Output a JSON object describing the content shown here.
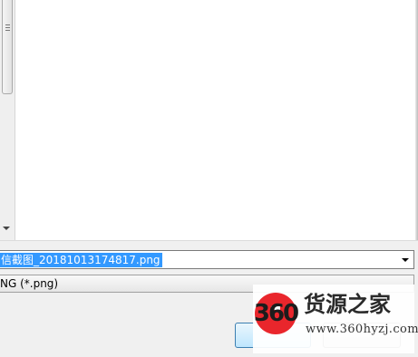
{
  "dialog": {
    "file_name": "信截图_20181013174817.png",
    "file_type": "NG (*.png)",
    "save_label": "",
    "cancel_label": ""
  },
  "watermark": {
    "logo_text": "360",
    "title": "货源之家",
    "url": "www.360hyzj.com"
  },
  "colors": {
    "selection": "#3399ff",
    "logo_red": "#e9262c"
  }
}
